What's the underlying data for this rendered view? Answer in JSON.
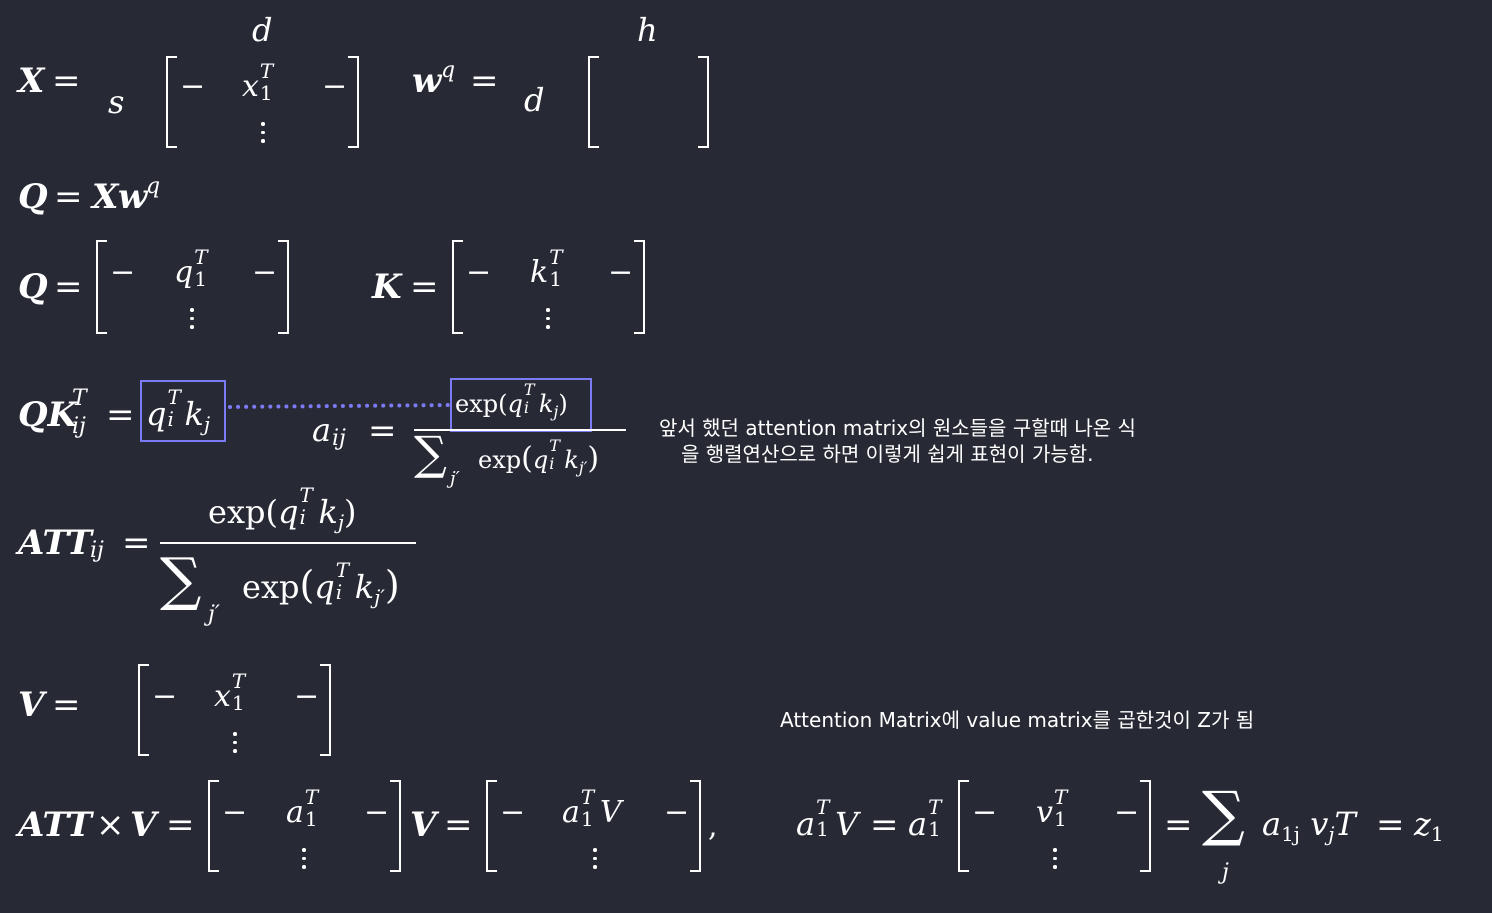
{
  "notes": {
    "attention_line1": "앞서 했던 attention matrix의 원소들을 구할때 나온 식",
    "attention_line2": "을 행렬연산으로 하면 이렇게 쉽게 표현이 가능함.",
    "value_note": "Attention Matrix에 value matrix를 곱한것이 Z가 됨"
  },
  "symbols": {
    "X": "X",
    "w": "w",
    "q": "q",
    "Q": "Q",
    "K": "K",
    "V": "V",
    "ATT": "ATT",
    "T": "T",
    "d": "d",
    "h": "h",
    "s": "s",
    "x": "x",
    "k": "k",
    "a": "a",
    "v": "v",
    "z": "z",
    "i": "i",
    "j": "j",
    "ij": "ij",
    "jprime": "j′",
    "one": "1",
    "onej": "1j",
    "eq": "=",
    "minus": "−",
    "times": "×",
    "comma": ",",
    "exp": "exp",
    "lp": "(",
    "rp": ")",
    "sum": "∑"
  },
  "colors": {
    "background": "#272a35",
    "text": "#ffffff",
    "highlight": "#7b7bf5"
  }
}
